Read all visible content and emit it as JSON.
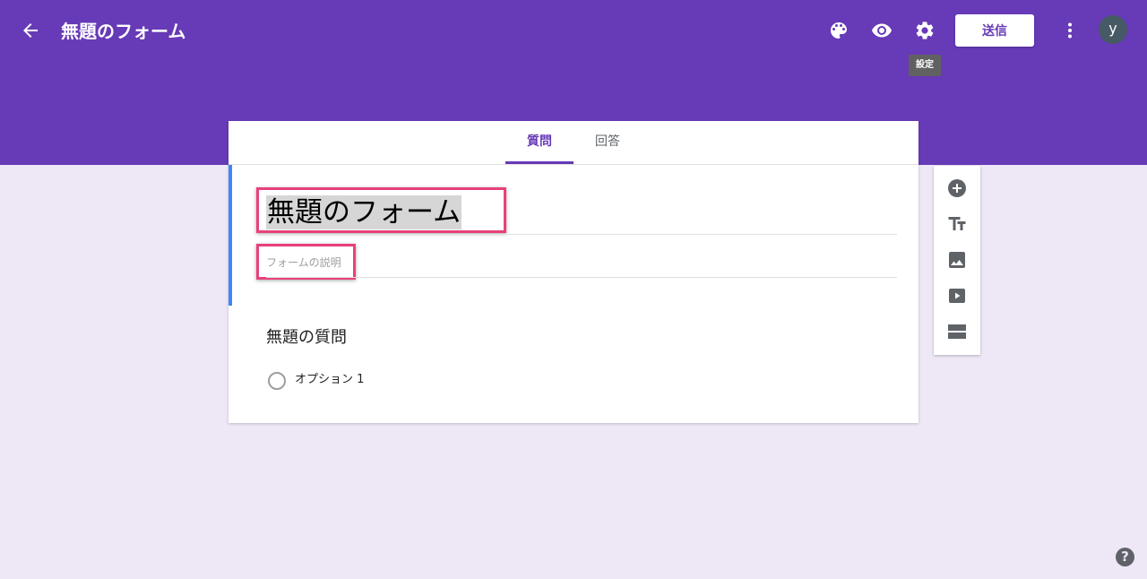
{
  "header": {
    "title": "無題のフォーム",
    "send_label": "送信",
    "avatar_initial": "y",
    "tooltip": "設定",
    "icons": [
      "arrow-back-icon",
      "palette-icon",
      "eye-icon",
      "gear-icon",
      "more-vert-icon"
    ]
  },
  "tabs": [
    {
      "label": "質問",
      "active": true
    },
    {
      "label": "回答",
      "active": false
    }
  ],
  "form": {
    "title": "無題のフォーム",
    "description_placeholder": "フォームの説明"
  },
  "question": {
    "title": "無題の質問",
    "options": [
      "オプション 1"
    ]
  },
  "side_toolbar": [
    "add-question-icon",
    "title-text-icon",
    "image-icon",
    "video-icon",
    "section-icon"
  ],
  "help": "?",
  "colors": {
    "primary": "#673ab7",
    "background": "#ede7f6",
    "highlight": "#e8407c",
    "focus": "#4285f4"
  }
}
